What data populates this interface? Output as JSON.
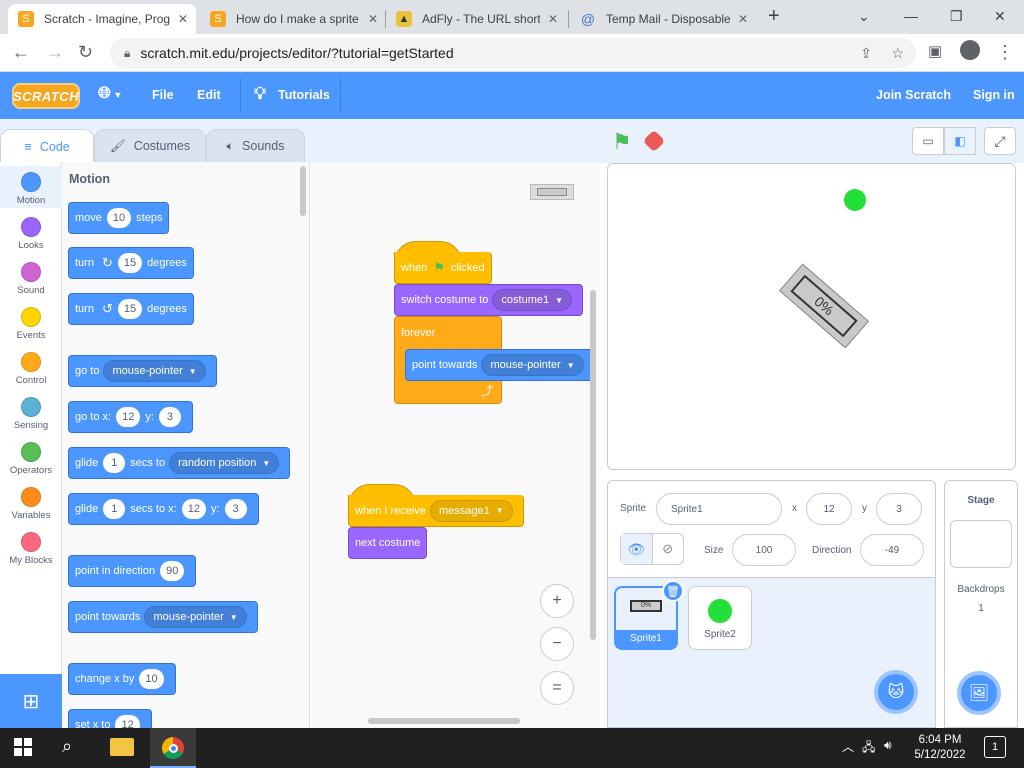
{
  "browser": {
    "tabs": [
      {
        "title": "Scratch - Imagine, Prog",
        "icon": "scratch-icon"
      },
      {
        "title": "How do I make a sprite",
        "icon": "scratch-icon"
      },
      {
        "title": "AdFly - The URL shorte",
        "icon": "adfly-icon"
      },
      {
        "title": "Temp Mail - Disposable",
        "icon": "tempmail-icon"
      }
    ],
    "url": "scratch.mit.edu/projects/editor/?tutorial=getStarted"
  },
  "menubar": {
    "logo": "SCRATCH",
    "file": "File",
    "edit": "Edit",
    "tutorials": "Tutorials",
    "join": "Join Scratch",
    "signin": "Sign in"
  },
  "editor_tabs": {
    "code": "Code",
    "costumes": "Costumes",
    "sounds": "Sounds"
  },
  "categories": [
    {
      "label": "Motion",
      "color": "#4c97ff"
    },
    {
      "label": "Looks",
      "color": "#9966ff"
    },
    {
      "label": "Sound",
      "color": "#cf63cf"
    },
    {
      "label": "Events",
      "color": "#ffd500"
    },
    {
      "label": "Control",
      "color": "#ffab19"
    },
    {
      "label": "Sensing",
      "color": "#5cb1d6"
    },
    {
      "label": "Operators",
      "color": "#59c059"
    },
    {
      "label": "Variables",
      "color": "#ff8c1a"
    },
    {
      "label": "My Blocks",
      "color": "#ff6680"
    }
  ],
  "palette": {
    "heading": "Motion",
    "move": {
      "pre": "move",
      "val": "10",
      "post": "steps"
    },
    "turn_right": {
      "pre": "turn",
      "val": "15",
      "post": "degrees"
    },
    "turn_left": {
      "pre": "turn",
      "val": "15",
      "post": "degrees"
    },
    "goto": {
      "pre": "go to",
      "dd": "mouse-pointer"
    },
    "gotoxy": {
      "pre": "go to x:",
      "x": "12",
      "ylbl": "y:",
      "y": "3"
    },
    "glide1": {
      "pre": "glide",
      "val": "1",
      "mid": "secs to",
      "dd": "random position"
    },
    "glide2": {
      "pre": "glide",
      "val": "1",
      "mid": "secs to x:",
      "x": "12",
      "ylbl": "y:",
      "y": "3"
    },
    "point_dir": {
      "pre": "point in direction",
      "val": "90"
    },
    "point_towards": {
      "pre": "point towards",
      "dd": "mouse-pointer"
    },
    "change_x": {
      "pre": "change x by",
      "val": "10"
    },
    "set_x": {
      "pre": "set x to",
      "val": "12"
    }
  },
  "script1": {
    "hat": {
      "pre": "when",
      "post": "clicked"
    },
    "switch": {
      "pre": "switch costume to",
      "dd": "costume1"
    },
    "forever": "forever",
    "point": {
      "pre": "point towards",
      "dd": "mouse-pointer"
    }
  },
  "script2": {
    "hat": {
      "pre": "when I receive",
      "dd": "message1"
    },
    "next": "next costume"
  },
  "zoom": {
    "in": "+",
    "out": "−",
    "reset": "="
  },
  "stage": {
    "sprite_costume_text": "%0"
  },
  "sprite_info": {
    "sprite_label": "Sprite",
    "sprite_name": "Sprite1",
    "x_label": "x",
    "x": "12",
    "y_label": "y",
    "y": "3",
    "size_label": "Size",
    "size": "100",
    "direction_label": "Direction",
    "direction": "-49"
  },
  "sprites": [
    {
      "name": "Sprite1",
      "thumb_text": "0%"
    },
    {
      "name": "Sprite2"
    }
  ],
  "stage_panel": {
    "title": "Stage",
    "backdrops_label": "Backdrops",
    "backdrops_count": "1"
  },
  "taskbar": {
    "time": "6:04 PM",
    "date": "5/12/2022",
    "notifications": "1"
  }
}
